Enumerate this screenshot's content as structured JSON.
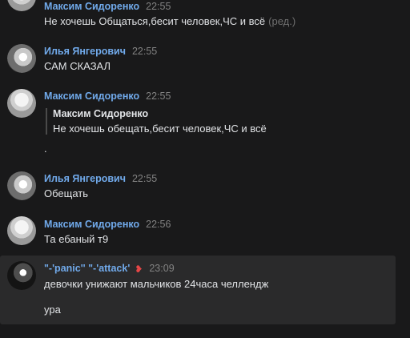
{
  "messages": [
    {
      "author": "Максим Сидоренко",
      "time": "22:55",
      "text": "Не хочешь Общаться,бесит человек,ЧС и всё",
      "edited": "(ред.)"
    },
    {
      "author": "Илья Янгерович",
      "time": "22:55",
      "text": "САМ СКАЗАЛ"
    },
    {
      "author": "Максим Сидоренко",
      "time": "22:55",
      "quote": {
        "author": "Максим Сидоренко",
        "text": "Не хочешь обещать,бесит человек,ЧС и всё"
      },
      "text": "."
    },
    {
      "author": "Илья Янгерович",
      "time": "22:55",
      "text": "Обещать"
    },
    {
      "author": "Максим Сидоренко",
      "time": "22:56",
      "text": "Та ебаный т9"
    },
    {
      "author": "\"-'panic'' \"-'attack'",
      "time": "23:09",
      "text_line1": "девочки унижают мальчиков 24часа челлендж",
      "text_line2": "ура",
      "badge_icon": "heart-swirl-icon"
    }
  ],
  "colors": {
    "background": "#19191a",
    "author_name": "#71aaeb",
    "timestamp": "#828282",
    "highlight": "#2a2a2b"
  }
}
